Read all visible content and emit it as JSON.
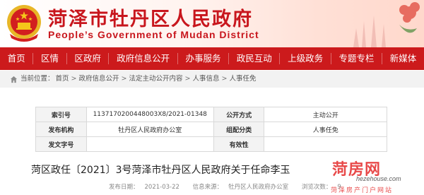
{
  "header": {
    "title": "菏泽市牡丹区人民政府",
    "subtitle": "People’s Government of Mudan District"
  },
  "nav": {
    "items": [
      "首页",
      "区情",
      "区政府",
      "政府信息公开",
      "办事服务",
      "政民互动",
      "上级政务",
      "专题专栏",
      "新媒体"
    ]
  },
  "breadcrumb": {
    "label": "当前位置：",
    "items": [
      "首页",
      "政府信息公开",
      "法定主动公开内容",
      "人事信息",
      "人事任免"
    ]
  },
  "meta_table": {
    "rows": [
      {
        "k1": "索引号",
        "v1": "1137170200448003X8/2021-01348",
        "k2": "公开方式",
        "v2": "主动公开"
      },
      {
        "k1": "发布机构",
        "v1": "牡丹区人民政府办公室",
        "k2": "组配分类",
        "v2": "人事任免"
      },
      {
        "k1": "发文字号",
        "v1": "",
        "k2": "有效性",
        "v2": ""
      }
    ]
  },
  "article": {
    "title": "菏区政任〔2021〕3号菏泽市牡丹区人民政府关于任命李玉",
    "publish_label": "发布日期：",
    "publish_date": "2021-03-22",
    "source_label": "信息来源：",
    "source": "牡丹区人民政府办公室",
    "views_label": "浏览次数：",
    "views": "9"
  },
  "watermark": {
    "main": "菏房网",
    "url": "hezehouse.com",
    "foot": "菏泽房产门户网站"
  },
  "colors": {
    "brand_red": "#cc1a1c",
    "title_red": "#c8161d"
  }
}
